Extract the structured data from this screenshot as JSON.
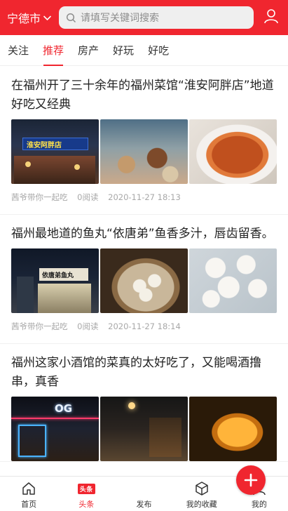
{
  "header": {
    "city": "宁德市",
    "search_placeholder": "请填写关键词搜索",
    "icons": {
      "chevron": "chevron-down-icon",
      "search": "search-icon",
      "user": "user-icon"
    }
  },
  "tabs": [
    {
      "label": "关注",
      "active": false
    },
    {
      "label": "推荐",
      "active": true
    },
    {
      "label": "房产",
      "active": false
    },
    {
      "label": "好玩",
      "active": false
    },
    {
      "label": "好吃",
      "active": false
    }
  ],
  "articles": [
    {
      "title": "在福州开了三十余年的福州菜馆“淮安阿胖店”地道好吃又经典",
      "author": "茜爷带你一起吃",
      "reads": "0阅读",
      "time": "2020-11-27 18:13",
      "sign_text": "淮安阿胖店"
    },
    {
      "title": "福州最地道的鱼丸“依唐弟”鱼香多汁，唇齿留香。",
      "author": "茜爷带你一起吃",
      "reads": "0阅读",
      "time": "2020-11-27 18:14",
      "sign_text": "依唐弟鱼丸"
    },
    {
      "title": "福州这家小酒馆的菜真的太好吃了，又能喝酒撸串，真香",
      "author": "",
      "reads": "",
      "time": "",
      "sign_text": "OG"
    }
  ],
  "bottom_nav": {
    "home": "首页",
    "headlines": "头条",
    "headlines_badge": "头条",
    "publish": "发布",
    "favorites": "我的收藏",
    "mine": "我的"
  },
  "colors": {
    "accent": "#f0262f",
    "meta_text": "#a8a8a8"
  }
}
